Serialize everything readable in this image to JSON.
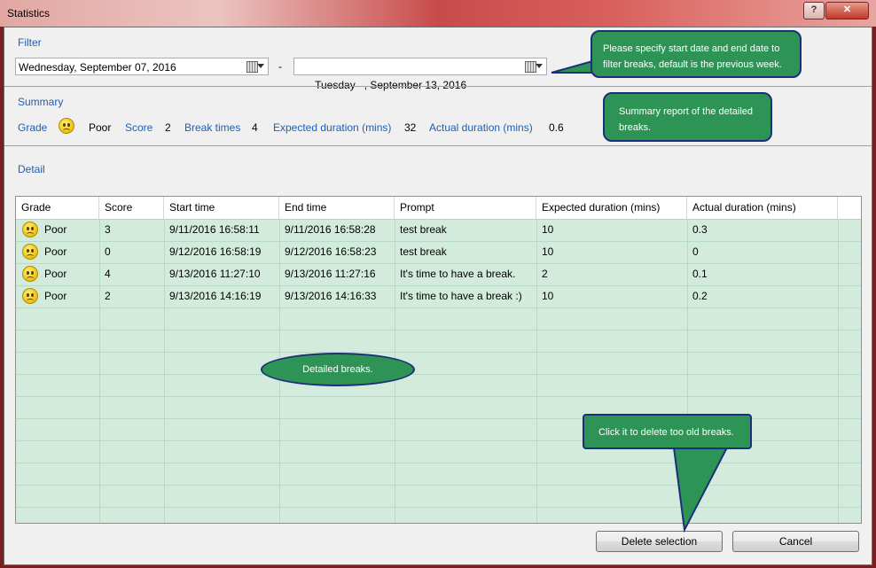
{
  "window": {
    "title": "Statistics",
    "help_label": "?",
    "close_label": "✕"
  },
  "filter": {
    "label": "Filter",
    "start_date": "Wednesday, September 07, 2016",
    "separator": "-",
    "end_date": "Tuesday   , September 13, 2016"
  },
  "summary": {
    "label": "Summary",
    "grade_label": "Grade",
    "grade_value": "Poor",
    "score_label": "Score",
    "score_value": "2",
    "break_times_label": "Break times",
    "break_times_value": "4",
    "expected_label": "Expected duration (mins)",
    "expected_value": "32",
    "actual_label": "Actual duration (mins)",
    "actual_value": "0.6"
  },
  "detail": {
    "label": "Detail",
    "columns": [
      "Grade",
      "Score",
      "Start time",
      "End time",
      "Prompt",
      "Expected duration (mins)",
      "Actual duration (mins)"
    ],
    "rows": [
      {
        "grade": "Poor",
        "score": "3",
        "start": "9/11/2016 16:58:11",
        "end": "9/11/2016 16:58:28",
        "prompt": "test break",
        "expected": "10",
        "actual": "0.3"
      },
      {
        "grade": "Poor",
        "score": "0",
        "start": "9/12/2016 16:58:19",
        "end": "9/12/2016 16:58:23",
        "prompt": "test break",
        "expected": "10",
        "actual": "0"
      },
      {
        "grade": "Poor",
        "score": "4",
        "start": "9/13/2016 11:27:10",
        "end": "9/13/2016 11:27:16",
        "prompt": "It's time to have a break.",
        "expected": "2",
        "actual": "0.1"
      },
      {
        "grade": "Poor",
        "score": "2",
        "start": "9/13/2016 14:16:19",
        "end": "9/13/2016 14:16:33",
        "prompt": "It's time to have a break :)",
        "expected": "10",
        "actual": "0.2"
      }
    ]
  },
  "buttons": {
    "delete": "Delete selection",
    "cancel": "Cancel"
  },
  "callouts": {
    "filter": "Please specify start date and end date to filter breaks, default is the previous week.",
    "summary": "Summary report of the detailed breaks.",
    "detail": "Detailed breaks.",
    "delete": "Click it to delete too old breaks."
  },
  "colors": {
    "accent": "#1e5fb4",
    "grid_bg": "#d3ebdd",
    "callout": "#2e9456",
    "callout_border": "#1b2f7a"
  },
  "icons": {
    "grade": "sad-face-icon",
    "calendar": "calendar-icon"
  }
}
